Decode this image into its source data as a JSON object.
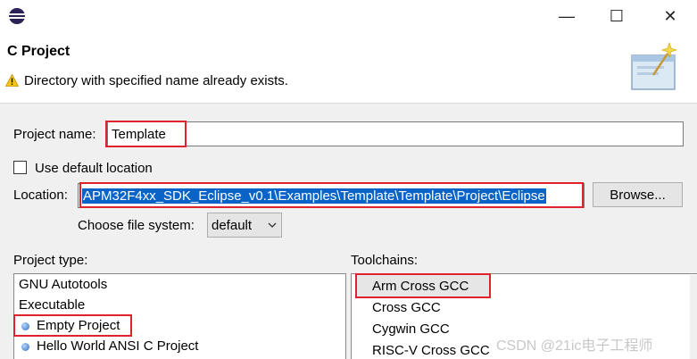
{
  "window": {
    "title": "C Project",
    "minimize_glyph": "—",
    "maximize_glyph": "☐",
    "close_glyph": "✕"
  },
  "banner": {
    "title": "C Project",
    "message": "Directory with specified name already exists.",
    "message_icon": "warning-icon"
  },
  "form": {
    "project_name_label": "Project name:",
    "project_name_value": "Template",
    "use_default_location_label": "Use default location",
    "use_default_location_checked": false,
    "location_label": "Location:",
    "location_value": "APM32F4xx_SDK_Eclipse_v0.1\\Examples\\Template\\Template\\Project\\Eclipse",
    "browse_label": "Browse...",
    "file_system_label": "Choose file system:",
    "file_system_value": "default"
  },
  "project_type": {
    "label": "Project type:",
    "items": [
      {
        "label": "GNU Autotools"
      },
      {
        "label": "Executable"
      },
      {
        "label": "Empty Project"
      },
      {
        "label": "Hello World ANSI C Project"
      }
    ]
  },
  "toolchains": {
    "label": "Toolchains:",
    "items": [
      {
        "label": "Arm Cross GCC"
      },
      {
        "label": "Cross GCC"
      },
      {
        "label": "Cygwin GCC"
      },
      {
        "label": "RISC-V Cross GCC"
      }
    ]
  },
  "watermark": "CSDN @21ic电子工程师",
  "colors": {
    "highlight_box": "#e0222a",
    "selection": "#0a64c8",
    "bullet": "#2a6cc0"
  }
}
